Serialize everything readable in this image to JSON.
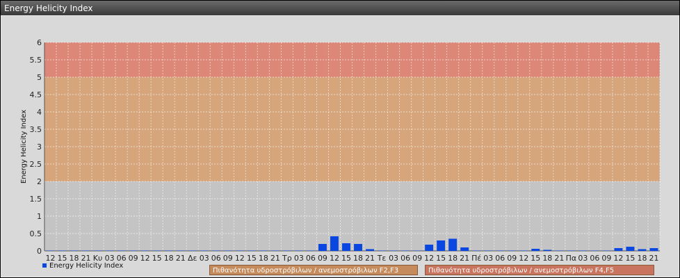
{
  "window": {
    "title": "Energy Helicity Index"
  },
  "legend": {
    "series_label": "Energy Helicity Index",
    "series_color": "#0a47e0"
  },
  "bands": [
    {
      "label": "Πιθανότητα υδροστρόβιλων / ανεμοστρόβιλων F2,F3",
      "from": 2,
      "to": 5,
      "color": "#d9a06f"
    },
    {
      "label": "Πιθανότητα υδροστρόβιλων / ανεμοστρόβιλων F4,F5",
      "from": 5,
      "to": 6,
      "color": "#e07d6a"
    }
  ],
  "chart_data": {
    "type": "bar",
    "title": "",
    "ylabel": "Energy Helicity Index",
    "ylim": [
      0,
      6
    ],
    "yticks": [
      "0",
      "0.5",
      "1",
      "1.5",
      "2",
      "2.5",
      "3",
      "3.5",
      "4",
      "4.5",
      "5",
      "5.5",
      "6"
    ],
    "grid": true,
    "categories": [
      "12",
      "15",
      "18",
      "21",
      "Κυ",
      "03",
      "06",
      "09",
      "12",
      "15",
      "18",
      "21",
      "Δε",
      "03",
      "06",
      "09",
      "12",
      "15",
      "18",
      "21",
      "Τρ",
      "03",
      "06",
      "09",
      "12",
      "15",
      "18",
      "21",
      "Τε",
      "03",
      "06",
      "09",
      "12",
      "15",
      "18",
      "21",
      "Πέ",
      "03",
      "06",
      "09",
      "12",
      "15",
      "18",
      "21",
      "Πα",
      "03",
      "06",
      "09",
      "12",
      "15",
      "18",
      "21"
    ],
    "series": [
      {
        "name": "Energy Helicity Index",
        "values": [
          0.01,
          0.01,
          0.01,
          0.01,
          0.01,
          0.01,
          0.01,
          0.01,
          0.01,
          0.01,
          0.01,
          0.01,
          0.01,
          0.01,
          0.01,
          0.01,
          0.01,
          0.01,
          0.01,
          0.01,
          0.01,
          0.01,
          0.01,
          0.2,
          0.42,
          0.22,
          0.2,
          0.05,
          0.01,
          0.01,
          0.01,
          0.01,
          0.18,
          0.3,
          0.35,
          0.1,
          0.01,
          0.01,
          0.01,
          0.01,
          0.01,
          0.06,
          0.03,
          0.01,
          0.01,
          0.01,
          0.01,
          0.01,
          0.08,
          0.12,
          0.05,
          0.08
        ]
      }
    ]
  }
}
